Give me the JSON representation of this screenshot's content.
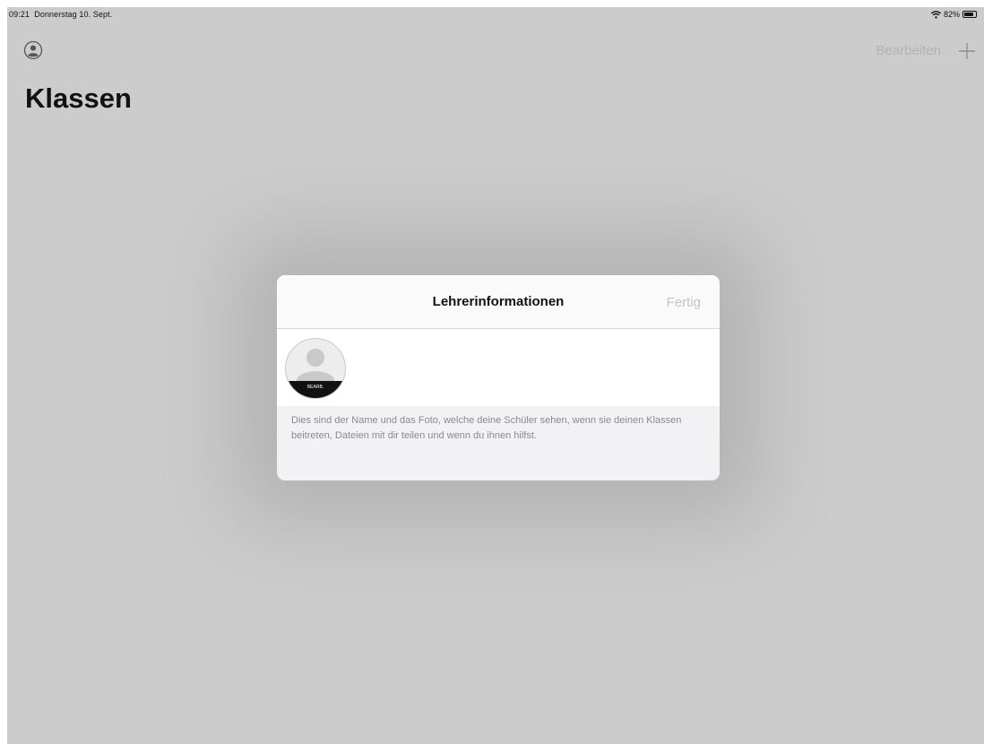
{
  "status_bar": {
    "time": "09:21",
    "date": "Donnerstag 10. Sept.",
    "battery": "82%",
    "battery_level": 0.82,
    "wifi_icon": "wifi-icon"
  },
  "nav": {
    "profile_icon": "person-circle-icon",
    "edit_label": "Bearbeiten",
    "add_icon": "plus-icon"
  },
  "page": {
    "title": "Klassen"
  },
  "modal": {
    "title": "Lehrerinformationen",
    "done_label": "Fertig",
    "avatar_edit_label": "BEARB.",
    "footer_text": "Dies sind der Name und das Foto, welche deine Schüler sehen, wenn sie deinen Klassen beitreten, Dateien mit dir teilen und wenn du ihnen hilfst."
  },
  "colors": {
    "background": "#cccccc",
    "modal_background": "#f2f2f4",
    "disabled_text": "#b3b3b3"
  }
}
